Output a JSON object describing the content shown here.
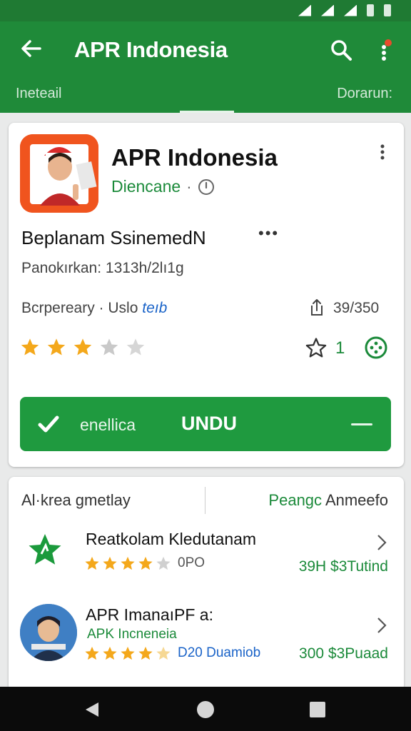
{
  "appbar": {
    "title": "APR Indonesia"
  },
  "tabs": {
    "left": "Ineteail",
    "right": "Dorarun:"
  },
  "app": {
    "name": "APR Indonesia",
    "developer": "Diencane",
    "separator": "·",
    "subtitle": "Beplanam SsinemedN",
    "subtitle_more": "•••",
    "meta_line": "Panokırkan: 1313h/2lı1g",
    "meta2_prefix": "Bcrpereary · Uslo",
    "meta2_link": "teıb",
    "size": "39/350",
    "rating_stars": 3,
    "favorites": "1",
    "accent_color": "#1f9a3f"
  },
  "install": {
    "left_label": "enellica",
    "main_label": "UNDU"
  },
  "related": {
    "header_left": "Al·krea gmetlay",
    "header_right_g": "Peangc",
    "header_right": " Anmeefo",
    "items": [
      {
        "title": "Reatkolam Kledutanam",
        "rating": 4,
        "count": "0PO",
        "price": "39H $3Tutind"
      },
      {
        "title": "APR ImanaıPF a:",
        "subtitle": "APK Incneneia",
        "rating": 4,
        "count": "D20 Duamiob",
        "price": "300 $3Puaad"
      }
    ]
  }
}
